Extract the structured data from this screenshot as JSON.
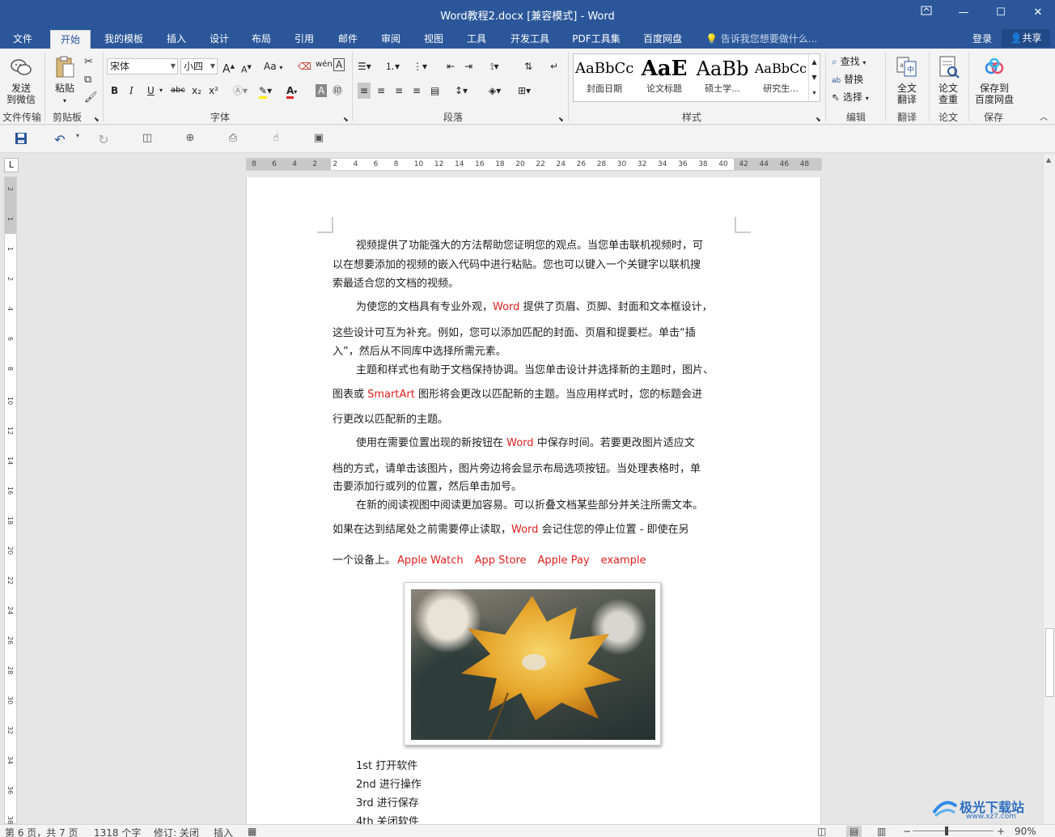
{
  "window": {
    "title": "Word教程2.docx [兼容模式] - Word",
    "restore_icon": "ribbon-display-icon",
    "minimize": "—",
    "maximize": "☐",
    "close": "✕"
  },
  "menu": {
    "tabs": [
      "文件",
      "开始",
      "我的模板",
      "插入",
      "设计",
      "布局",
      "引用",
      "邮件",
      "审阅",
      "视图",
      "工具",
      "开发工具",
      "PDF工具集",
      "百度网盘"
    ],
    "active_tab": "开始",
    "tell_me": "告诉我您想要做什么...",
    "login": "登录",
    "share": "共享"
  },
  "ribbon": {
    "wechat": {
      "label1": "发送",
      "label2": "到微信",
      "group": "文件传输"
    },
    "clipboard": {
      "paste": "粘贴",
      "group": "剪贴板"
    },
    "font": {
      "name": "宋体",
      "size": "小四",
      "group": "字体",
      "case_btn": "Aa",
      "bold": "B",
      "italic": "I",
      "underline": "U",
      "strike": "abc",
      "sub": "x₂",
      "sup": "x²",
      "grow": "A",
      "shrink": "A",
      "color_a": "A"
    },
    "paragraph": {
      "group": "段落"
    },
    "styles": {
      "group": "样式",
      "items": [
        {
          "preview": "AaBbCc",
          "name": "封面日期"
        },
        {
          "preview": "AaE",
          "name": "论文标题"
        },
        {
          "preview": "AaBb",
          "name": "硕士学..."
        },
        {
          "preview": "AaBbCc",
          "name": "研究生..."
        }
      ]
    },
    "editing": {
      "find": "查找",
      "replace": "替换",
      "select": "选择",
      "group": "编辑"
    },
    "translate": {
      "label1": "全文",
      "label2": "翻译",
      "group": "翻译"
    },
    "paper": {
      "label1": "论文",
      "label2": "查重",
      "group": "论文"
    },
    "save_cloud": {
      "label1": "保存到",
      "label2": "百度网盘",
      "group": "保存"
    }
  },
  "ruler": {
    "h_numbers": [
      "8",
      "6",
      "4",
      "2",
      "2",
      "4",
      "6",
      "8",
      "10",
      "12",
      "14",
      "16",
      "18",
      "20",
      "22",
      "24",
      "26",
      "28",
      "30",
      "32",
      "34",
      "36",
      "38",
      "40",
      "42",
      "44",
      "46",
      "48"
    ],
    "v_numbers": [
      "2",
      "1",
      "1",
      "2",
      "4",
      "6",
      "8",
      "10",
      "12",
      "14",
      "16",
      "18",
      "20",
      "22",
      "24",
      "26",
      "28",
      "30",
      "32",
      "34",
      "36",
      "38"
    ],
    "corner": "L"
  },
  "document": {
    "p1_l1": "视频提供了功能强大的方法帮助您证明您的观点。当您单击联机视频时，可",
    "p1_l2": "以在想要添加的视频的嵌入代码中进行粘贴。您也可以键入一个关键字以联机搜",
    "p1_l3": "索最适合您的文档的视频。",
    "p2_l1a": "为使您的文档具有专业外观，",
    "p2_l1_word": "Word",
    "p2_l1b": " 提供了页眉、页脚、封面和文本框设计，",
    "p2_l2": "这些设计可互为补充。例如，您可以添加匹配的封面、页眉和提要栏。单击“插",
    "p2_l3": "入”，然后从不同库中选择所需元素。",
    "p3_l1": "主题和样式也有助于文档保持协调。当您单击设计并选择新的主题时，图片、",
    "p3_l2a": "图表或 ",
    "p3_l2_smart": "SmartArt",
    "p3_l2b": " 图形将会更改以匹配新的主题。当应用样式时，您的标题会进",
    "p3_l3": "行更改以匹配新的主题。",
    "p4_l1a": "使用在需要位置出现的新按钮在 ",
    "p4_l1_word": "Word",
    "p4_l1b": " 中保存时间。若要更改图片适应文",
    "p4_l2": "档的方式，请单击该图片，图片旁边将会显示布局选项按钮。当处理表格时，单",
    "p4_l3": "击要添加行或列的位置，然后单击加号。",
    "p5_l1": "在新的阅读视图中阅读更加容易。可以折叠文档某些部分并关注所需文本。",
    "p5_l2a": "如果在达到结尾处之前需要停止读取，",
    "p5_l2_word": "Word",
    "p5_l2b": " 会记住您的停止位置 - 即使在另",
    "p5_l3a": "一个设备上。",
    "links": [
      "Apple Watch",
      "App Store",
      "Apple Pay",
      "example"
    ],
    "list": [
      "1st 打开软件",
      "2nd 进行操作",
      "3rd 进行保存",
      "4th 关闭软件"
    ]
  },
  "status": {
    "page": "第 6 页，共 7 页",
    "words": "1318 个字",
    "track": "修订: 关闭",
    "insert": "插入",
    "zoom": "90%"
  },
  "watermark": {
    "text1": "极光下载站",
    "text2": "www.xz7.com"
  },
  "colors": {
    "brand": "#2b579a",
    "link_red": "#e0201f",
    "ribbon_bg": "#f3f3f3"
  }
}
